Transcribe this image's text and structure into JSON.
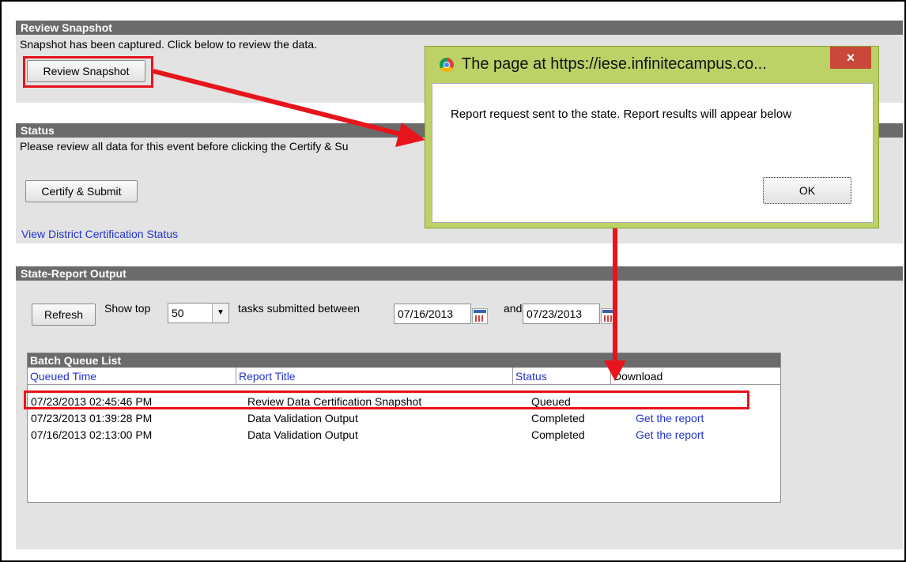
{
  "review_snapshot": {
    "header": "Review Snapshot",
    "message": "Snapshot has been captured. Click below to review the data.",
    "button": "Review Snapshot"
  },
  "status": {
    "header": "Status",
    "message": "Please review all data for this event before clicking the Certify & Su",
    "certify_button": "Certify & Submit",
    "link": "View District Certification Status"
  },
  "state_report": {
    "header": "State-Report Output",
    "refresh_button": "Refresh",
    "show_top_label": "Show top",
    "show_top_value": "50",
    "between_label": "tasks submitted between",
    "start_date": "07/16/2013",
    "and_label": "and",
    "end_date": "07/23/2013"
  },
  "batch_queue": {
    "header": "Batch Queue List",
    "columns": [
      "Queued Time",
      "Report Title",
      "Status",
      "Download"
    ],
    "rows": [
      {
        "time": "07/23/2013 02:45:46 PM",
        "title": "Review Data Certification Snapshot",
        "status": "Queued",
        "download": ""
      },
      {
        "time": "07/23/2013 01:39:28 PM",
        "title": "Data Validation Output",
        "status": "Completed",
        "download": "Get the report"
      },
      {
        "time": "07/16/2013 02:13:00 PM",
        "title": "Data Validation Output",
        "status": "Completed",
        "download": "Get the report"
      }
    ]
  },
  "dialog": {
    "title": "The page at https://iese.infinitecampus.co...",
    "message": "Report request sent to the state.  Report results will appear below",
    "ok_button": "OK",
    "close_symbol": "×"
  },
  "colors": {
    "annotation_red": "#e8141c",
    "panel_header": "#6b6b6b",
    "panel_bg": "#e3e3e3",
    "link_blue": "#2233cc",
    "dialog_frame": "#bcd267",
    "close_red": "#c9483a"
  }
}
